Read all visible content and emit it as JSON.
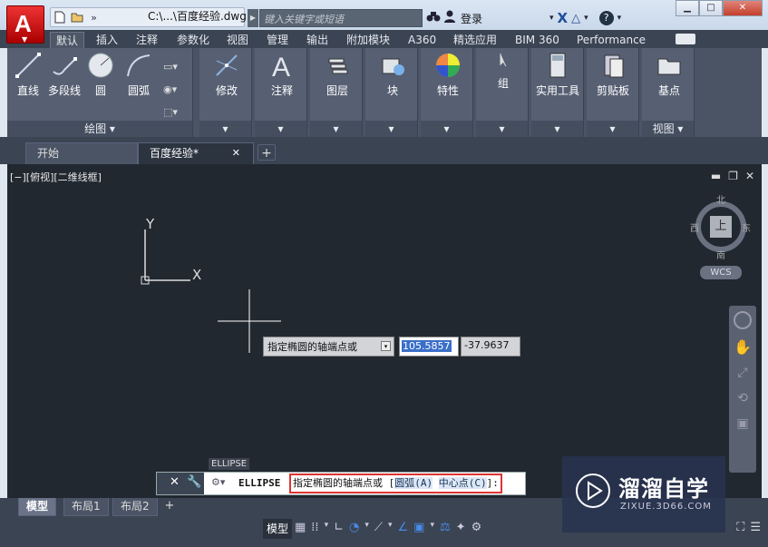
{
  "titlebar": {
    "doc_title": "C:\\...\\百度经验.dwg",
    "search_placeholder": "键入关键字或短语",
    "login_label": "登录",
    "help_label": "?"
  },
  "ribbon_tabs": [
    "默认",
    "插入",
    "注释",
    "参数化",
    "视图",
    "管理",
    "输出",
    "附加模块",
    "A360",
    "精选应用",
    "BIM 360",
    "Performance"
  ],
  "panels": {
    "draw": {
      "label": "绘图 ▾",
      "tools": [
        "直线",
        "多段线",
        "圆",
        "圆弧"
      ]
    },
    "modify": "修改",
    "annotation": "注释",
    "layers": "图层",
    "block": "块",
    "properties": "特性",
    "groups": "组",
    "utilities": "实用工具",
    "clipboard": "剪贴板",
    "view": {
      "tool": "基点",
      "label": "视图 ▾"
    }
  },
  "doc_tabs": {
    "start": "开始",
    "current": "百度经验*"
  },
  "viewport": {
    "label": "[−][俯视][二维线框]",
    "ucs_y": "Y",
    "ucs_x": "X"
  },
  "viewcube": {
    "north": "北",
    "south": "南",
    "west": "西",
    "east": "东",
    "face": "上",
    "wcs": "WCS"
  },
  "dynamic_input": {
    "prompt": "指定椭圆的轴端点或",
    "x_value": "105.5857",
    "y_value": "-37.9637"
  },
  "command": {
    "tooltip": "ELLIPSE",
    "name": "ELLIPSE",
    "prompt_text": "指定椭圆的轴端点或 [",
    "option_arc": "圆弧(A)",
    "option_center": "中心点(C)",
    "prompt_end": "]:"
  },
  "layout_tabs": [
    "模型",
    "布局1",
    "布局2"
  ],
  "statusbar": {
    "model_label": "模型"
  },
  "watermark": {
    "brand": "溜溜自学",
    "url": "ZIXUE.3D66.COM"
  },
  "colors": {
    "app_button": "#cc1f1f",
    "ribbon_bg": "#4b5465",
    "canvas_bg": "#212830",
    "highlight": "#3a6fc9",
    "cmd_border": "#dd3333"
  }
}
